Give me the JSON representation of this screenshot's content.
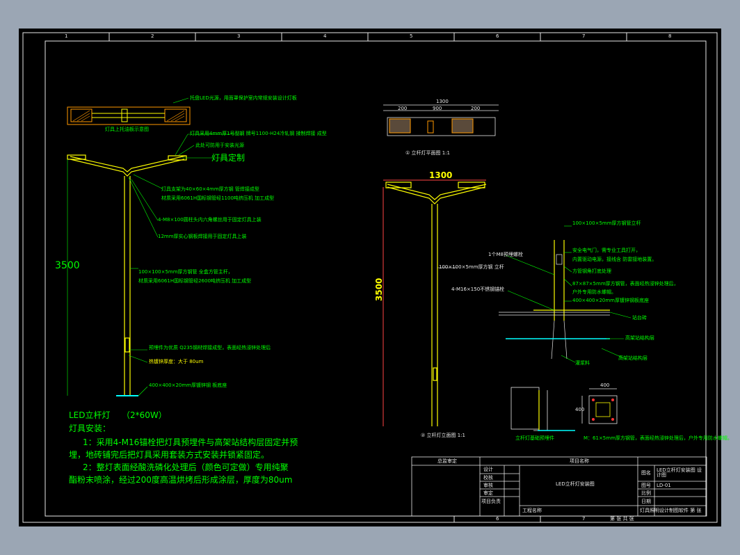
{
  "border": {
    "top_numbers": [
      "1",
      "2",
      "3",
      "4",
      "5",
      "6",
      "7",
      "8"
    ],
    "bottom_numbers": [
      "6",
      "7"
    ]
  },
  "left_view": {
    "height_dim": "3500",
    "section_caption": "灯具上托油板示意图",
    "callouts": [
      "托盘LED光源，用面罩保护室内常规安装设计灯板",
      "灯具采用4mm厚1号型钢 牌号1100-H24冷轧钢 揉制焊接 成型",
      "此处可防用于安装光源",
      "灯具定制",
      "灯具支架为40×60×4mm厚方钢 管焊接成型",
      "材质采用6061H国标钢管经1100吨挤压机 加工成型",
      "4-M8×100圆柱头内六角螺丝用于固定灯具上装",
      "12mm厚实心钢板焊接用于固定灯具上装",
      "100×100×5mm厚方钢管 全盒方管主杆，",
      "材质采用6061H国标钢管经2600吨挤压机 加工成型",
      "预埋件为优质 Q235钢材焊接成型，表面经热浸锌处理后",
      "热镀锌厚度：大于 80um",
      "400×400×20mm厚镀锌钢 板底座"
    ]
  },
  "notes": {
    "title": "LED立杆灯",
    "spec": "（2*60W）",
    "install_title": "灯具安装：",
    "lines": [
      "1：采用4-M16锚栓把灯具预埋件与高架站结构层固定并预",
      "埋，地砖铺完后把灯具采用套装方式安装并锁紧固定。",
      "2：整灯表面经酸洗磷化处理后（颜色可定做）专用纯聚",
      "酯粉末喷涂，经过200度高温烘烤后形成涂层，厚度为80um"
    ]
  },
  "top_section": {
    "dims": [
      "1300",
      "200",
      "900",
      "200"
    ],
    "caption": "① 立杆灯平面图 1:1"
  },
  "mid_elevation": {
    "width_dim": "1300",
    "height_dim": "3500",
    "callouts": [
      "100×100×5mm厚方钢 立杆",
      "4-M16×150不锈钢锚栓"
    ],
    "caption": "② 立杆灯立面图 1:1"
  },
  "detail": {
    "callouts": [
      "100×100×5mm厚方钢管立杆",
      "安全电气门，需专业工具打开，",
      "内置驱动电源，接线含 防雷接地装置。",
      "方管钢角打底处理",
      "87×87×5mm厚方钢管，表面经热浸锌处理后，",
      "户外专用防水螺帽。",
      "400×400×20mm厚镀锌钢板底座",
      "站台砖",
      "高架站结构层",
      "高架站结构层",
      "灌浆料"
    ],
    "top_note": "1个M8预埋螺栓",
    "caption": "立杆灯基础预埋件",
    "plate_note": "M：61×5mm厚方钢管，表面经热浸锌处理后，户外专用防水螺帽。",
    "plate_dims": [
      "400",
      "400"
    ]
  },
  "title_block": {
    "left_header": "总监审定",
    "project_header": "项目名称",
    "rows": [
      "设计",
      "校核",
      "审核",
      "审定",
      "项目负责"
    ],
    "drawing_name": "LED立杆灯安装图",
    "project_label": "工程名称",
    "right_labels": [
      "图名",
      "图号",
      "比例",
      "日期"
    ],
    "right_values": [
      "LED立杆灯安装图 设计图",
      "LD-01",
      "",
      ""
    ],
    "footer_left": "灯具照明设计制图软件 第 张",
    "footer_right": "第 张 共 张"
  }
}
